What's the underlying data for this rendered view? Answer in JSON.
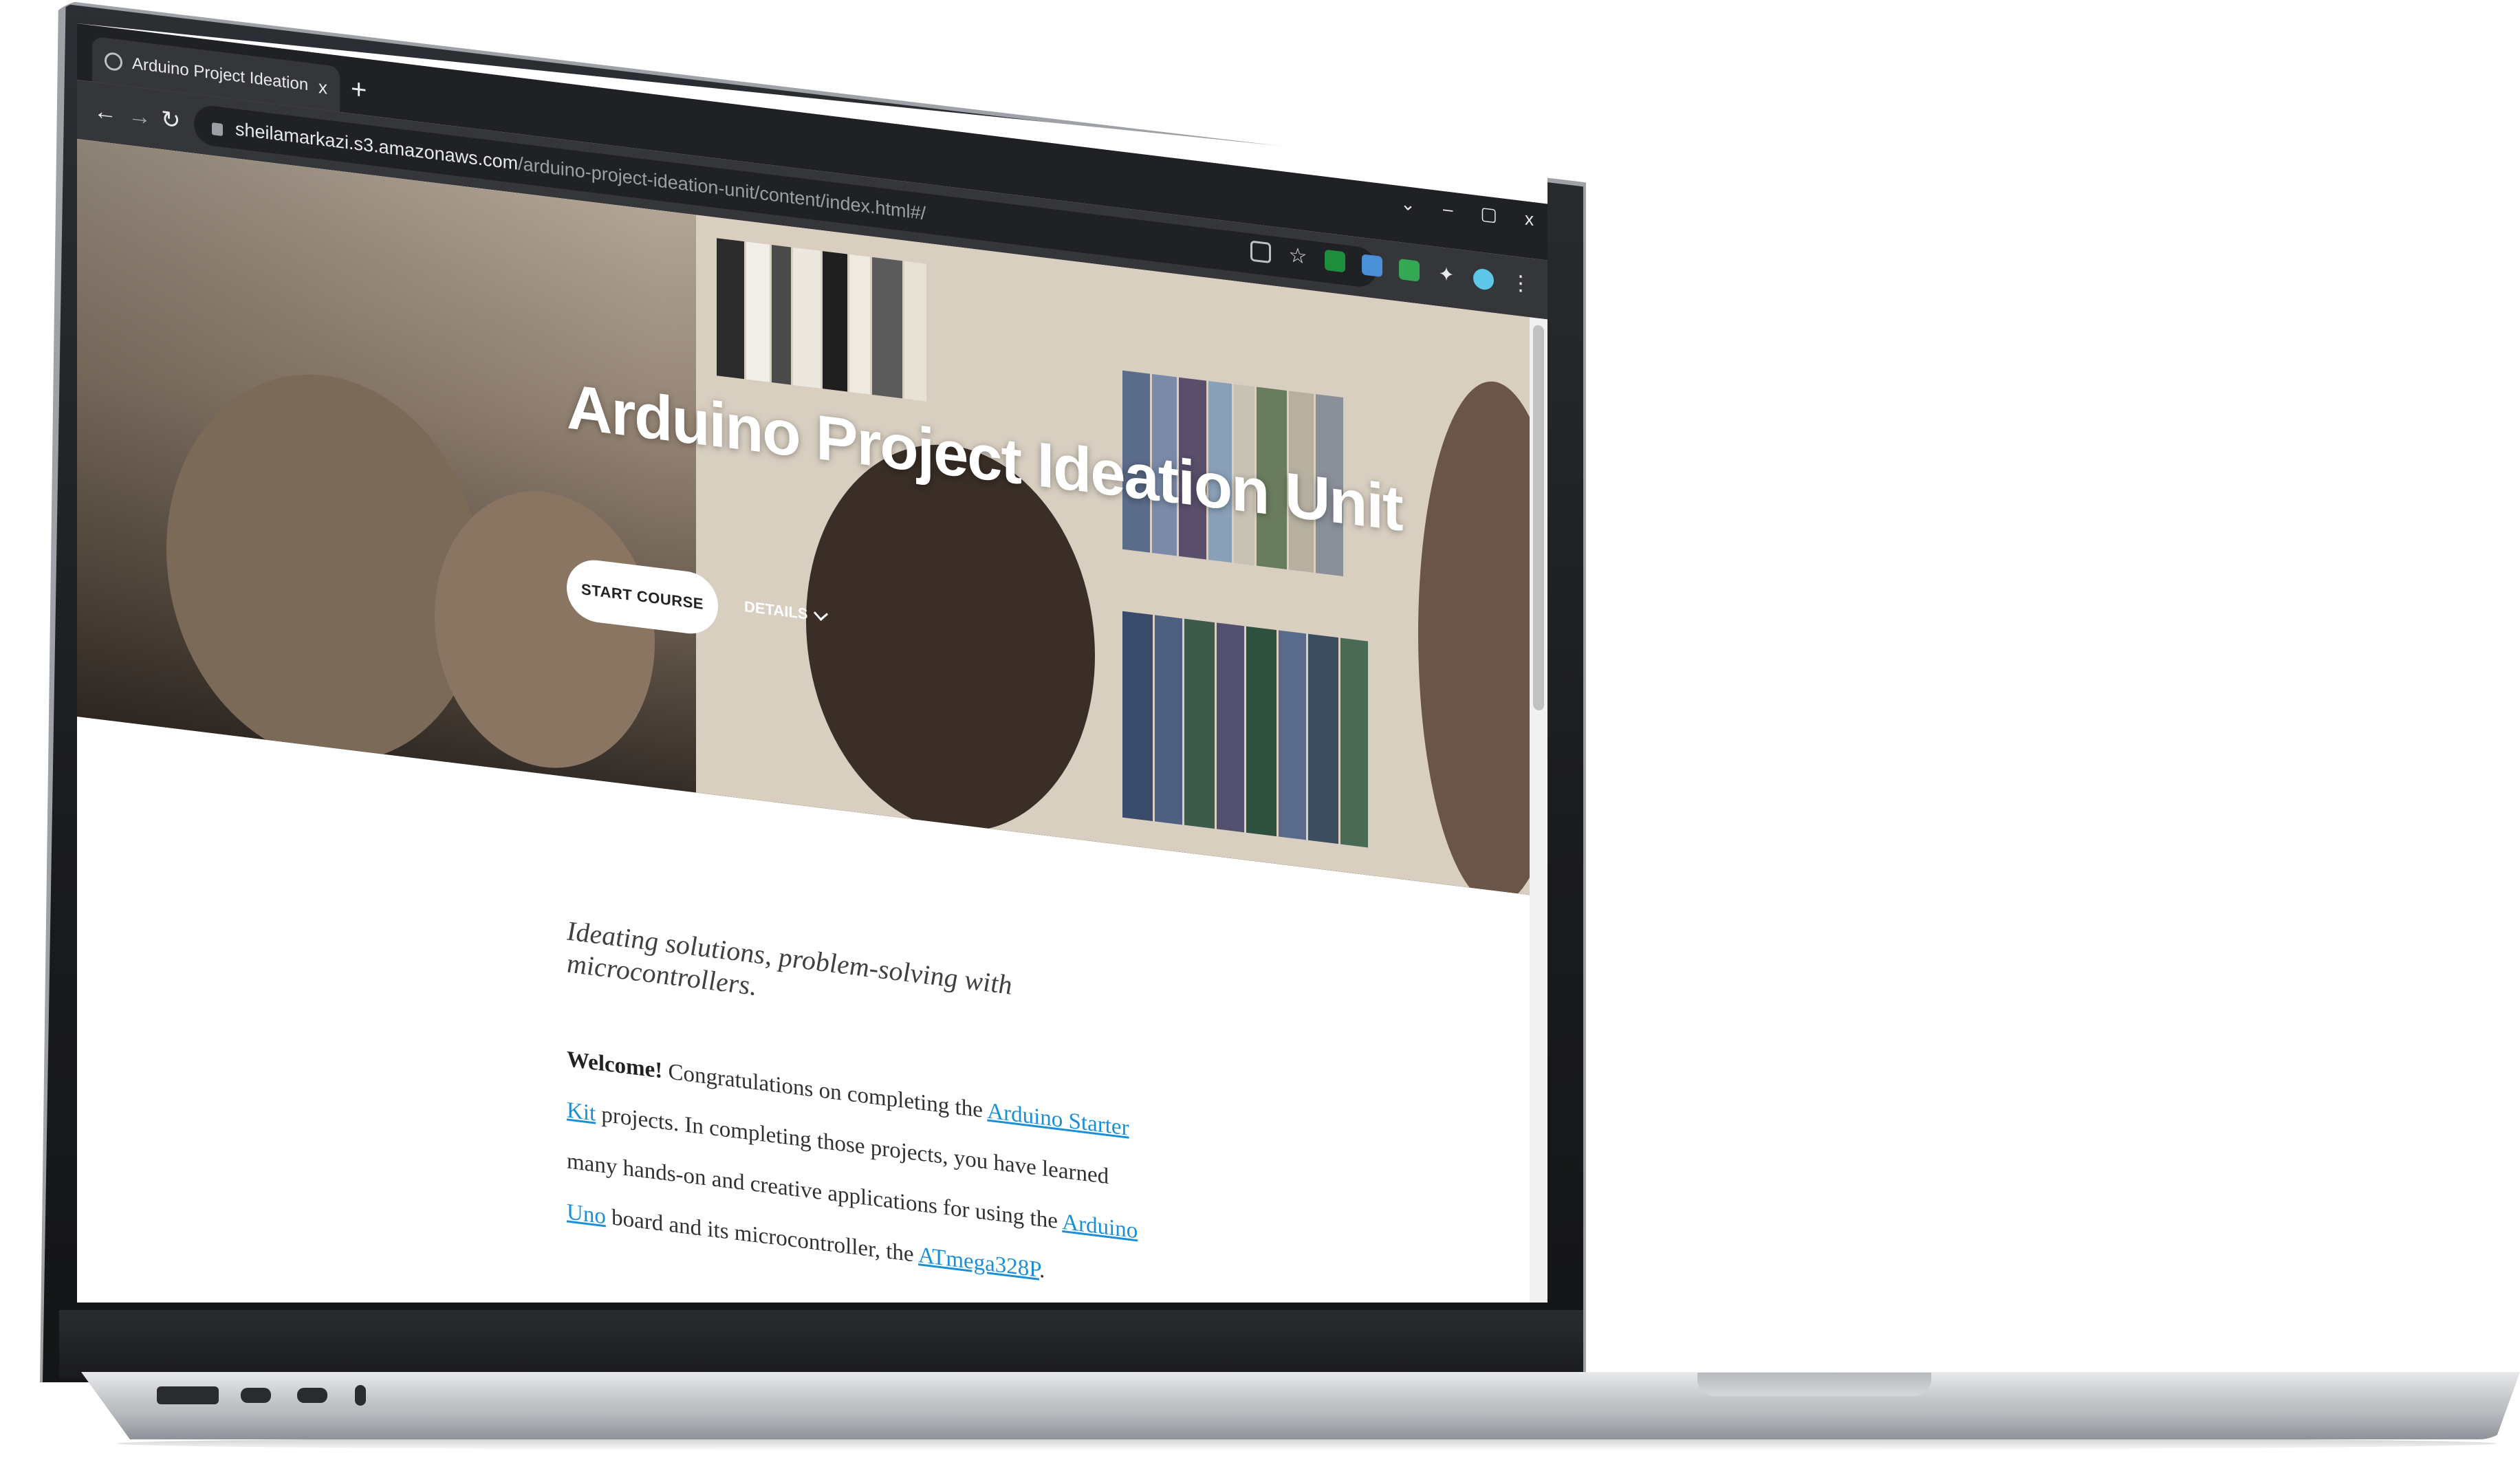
{
  "browser": {
    "tab_title": "Arduino Project Ideation Unit - C",
    "tab_close": "x",
    "new_tab": "+",
    "url_host": "sheilamarkazi.s3.amazonaws.com",
    "url_path": "/arduino-project-ideation-unit/content/index.html#/",
    "window_controls": [
      "⌄",
      "–",
      "▢",
      "x"
    ],
    "nav": {
      "back": "←",
      "forward": "→",
      "reload": "↻"
    }
  },
  "hero": {
    "title": "Arduino Project Ideation Unit",
    "start_label": "START COURSE",
    "details_label": "DETAILS"
  },
  "content": {
    "tagline": "Ideating solutions, problem-solving with microcontrollers.",
    "welcome_bold": "Welcome!",
    "p1_a": " Congratulations on completing the ",
    "link_starter_kit": "Arduino Starter Kit",
    "p1_b": " projects. In completing those projects, you have learned many hands-on and creative applications for using the ",
    "link_uno": "Arduino Uno",
    "p1_c": " board and its microcontroller, the ",
    "link_atmega": "ATmega328P",
    "p1_d": "."
  },
  "colors": {
    "link": "#1b8fd6",
    "chrome_dark": "#202124",
    "chrome_toolbar": "#35363a"
  }
}
